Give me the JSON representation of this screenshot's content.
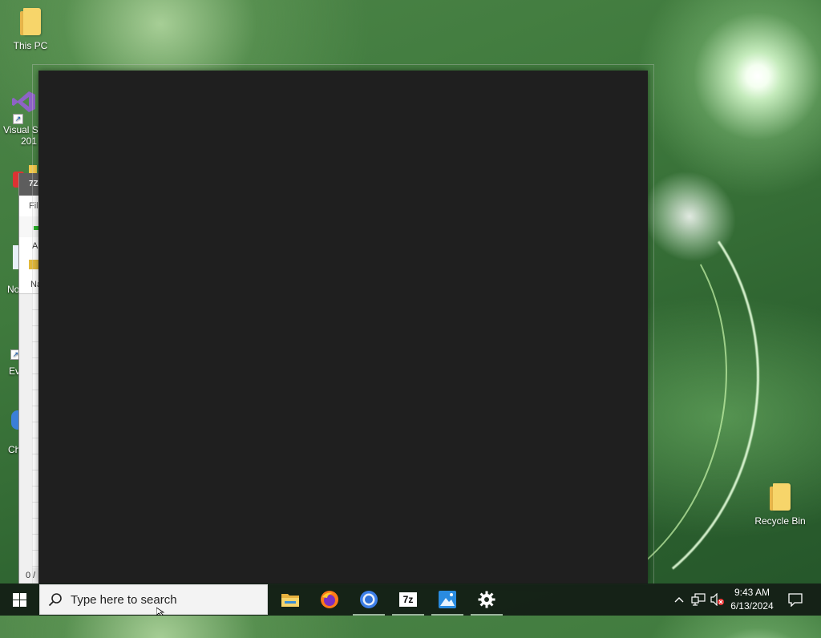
{
  "desktop": {
    "icons": [
      {
        "label": "This PC"
      },
      {
        "label": "Visual St"
      },
      {
        "label": "201"
      },
      {
        "label": "No"
      },
      {
        "label": "Ev"
      },
      {
        "label": "Ch"
      },
      {
        "label": "Recycle Bin"
      }
    ]
  },
  "background_window": {
    "title_fragment": "7Z",
    "menu_fragment": "Fil",
    "toolbar_fragment": "A",
    "header_fragment": "Na",
    "status_fragment": "0 /"
  },
  "taskbar": {
    "search_placeholder": "Type here to search",
    "apps": [
      {
        "name": "file-explorer",
        "label": ""
      },
      {
        "name": "firefox",
        "label": ""
      },
      {
        "name": "chrome",
        "label": ""
      },
      {
        "name": "7zip",
        "label": "7z"
      },
      {
        "name": "photos",
        "label": ""
      },
      {
        "name": "settings",
        "label": ""
      }
    ],
    "clock": {
      "time": "9:43 AM",
      "date": "6/13/2024"
    }
  },
  "colors": {
    "taskbar": "#14201a",
    "dark_window": "#1f1f1f",
    "folder": "#f7d56a"
  }
}
